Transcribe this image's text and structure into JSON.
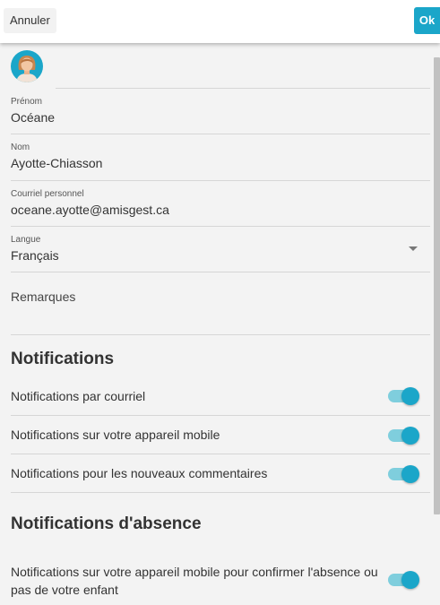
{
  "header": {
    "cancel_label": "Annuler",
    "ok_label": "Ok"
  },
  "profile": {
    "first_name": {
      "label": "Prénom",
      "value": "Océane"
    },
    "last_name": {
      "label": "Nom",
      "value": "Ayotte-Chiasson"
    },
    "email": {
      "label": "Courriel personnel",
      "value": "oceane.ayotte@amisgest.ca"
    },
    "language": {
      "label": "Langue",
      "value": "Français"
    },
    "remarks_label": "Remarques"
  },
  "notifications": {
    "title": "Notifications",
    "items": [
      {
        "label": "Notifications par courriel",
        "enabled": true
      },
      {
        "label": "Notifications sur votre appareil mobile",
        "enabled": true
      },
      {
        "label": "Notifications pour les nouveaux commentaires",
        "enabled": true
      }
    ]
  },
  "absence": {
    "title": "Notifications d'absence",
    "items": [
      {
        "label": "Notifications sur votre appareil mobile pour confirmer l'absence ou pas de votre enfant",
        "enabled": true
      }
    ]
  },
  "colors": {
    "accent": "#1ba6c9",
    "toggle_track": "#7fcedd",
    "background": "#f3f3f3"
  },
  "icons": {
    "avatar": "user-avatar-icon",
    "dropdown": "caret-down-icon"
  }
}
